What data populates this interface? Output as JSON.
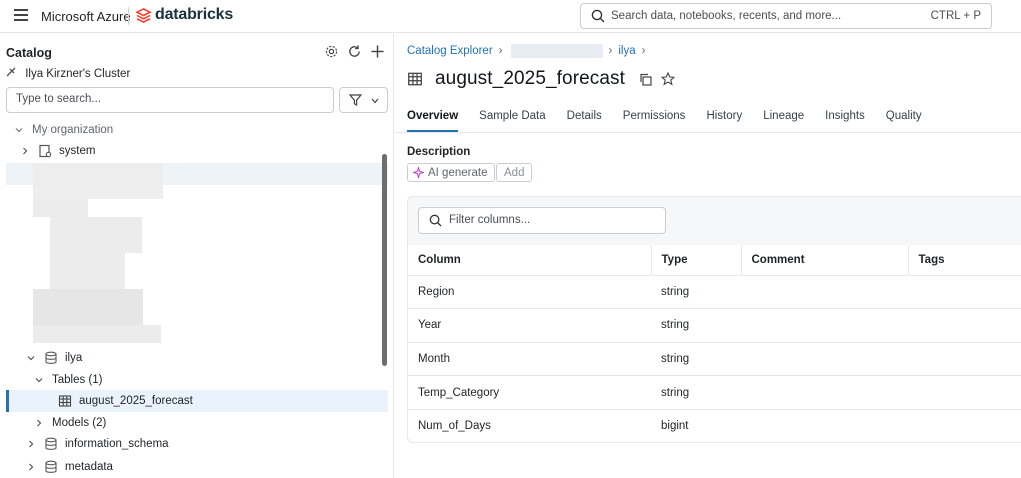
{
  "topbar": {
    "provider": "Microsoft Azure",
    "brand": "databricks",
    "search_placeholder": "Search data, notebooks, recents, and more...",
    "search_shortcut": "CTRL + P"
  },
  "sidebar": {
    "title": "Catalog",
    "cluster": "Ilya Kirzner's Cluster",
    "search_placeholder": "Type to search...",
    "tree": {
      "root": "My organization",
      "system": "system",
      "schema": "ilya",
      "tables_group": "Tables (1)",
      "selected_table": "august_2025_forecast",
      "models_group": "Models (2)",
      "information_schema": "information_schema",
      "metadata": "metadata"
    }
  },
  "main": {
    "breadcrumb": {
      "root": "Catalog Explorer",
      "schema": "ilya"
    },
    "title": "august_2025_forecast",
    "tabs": [
      "Overview",
      "Sample Data",
      "Details",
      "Permissions",
      "History",
      "Lineage",
      "Insights",
      "Quality"
    ],
    "active_tab": "Overview",
    "description": {
      "label": "Description",
      "ai_button": "AI generate",
      "add_button": "Add"
    },
    "columns": {
      "filter_placeholder": "Filter columns...",
      "headers": [
        "Column",
        "Type",
        "Comment",
        "Tags"
      ],
      "rows": [
        {
          "name": "Region",
          "type": "string"
        },
        {
          "name": "Year",
          "type": "string"
        },
        {
          "name": "Month",
          "type": "string"
        },
        {
          "name": "Temp_Category",
          "type": "string"
        },
        {
          "name": "Num_of_Days",
          "type": "bigint"
        }
      ]
    }
  },
  "colors": {
    "accent": "#2272b4",
    "brand": "#ff3621",
    "selected_row": "#eaf2fb"
  }
}
